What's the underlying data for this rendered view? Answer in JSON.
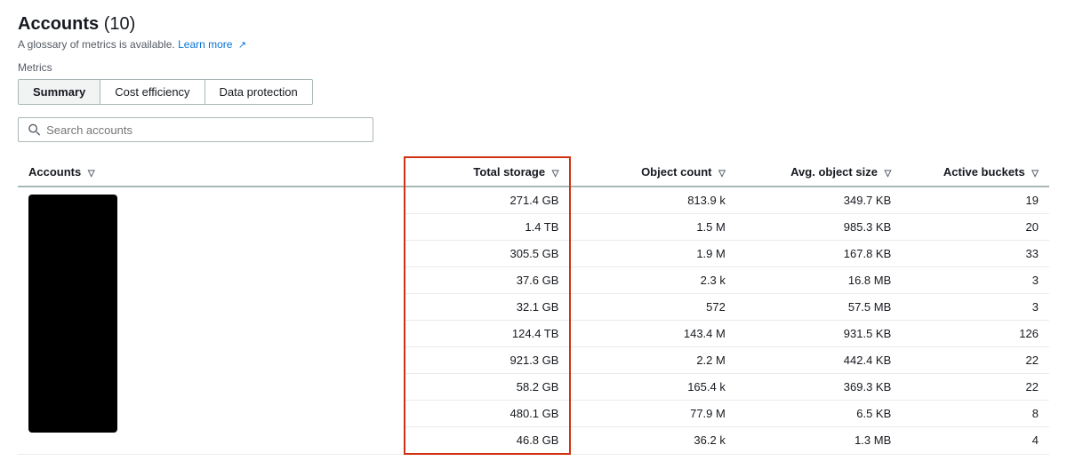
{
  "header": {
    "title": "Accounts",
    "count": "(10)",
    "glossary_text": "A glossary of metrics is available.",
    "learn_more": "Learn more",
    "learn_more_icon": "external-link-icon"
  },
  "metrics_label": "Metrics",
  "tabs": [
    {
      "id": "summary",
      "label": "Summary",
      "active": true
    },
    {
      "id": "cost-efficiency",
      "label": "Cost efficiency",
      "active": false
    },
    {
      "id": "data-protection",
      "label": "Data protection",
      "active": false
    }
  ],
  "search": {
    "placeholder": "Search accounts",
    "value": ""
  },
  "table": {
    "columns": [
      {
        "id": "accounts",
        "label": "Accounts",
        "sortable": true
      },
      {
        "id": "total_storage",
        "label": "Total storage",
        "sortable": true,
        "highlighted": true
      },
      {
        "id": "object_count",
        "label": "Object count",
        "sortable": true
      },
      {
        "id": "avg_object_size",
        "label": "Avg. object size",
        "sortable": true
      },
      {
        "id": "active_buckets",
        "label": "Active buckets",
        "sortable": true
      }
    ],
    "rows": [
      {
        "accounts": "",
        "total_storage": "271.4 GB",
        "object_count": "813.9 k",
        "avg_object_size": "349.7 KB",
        "active_buckets": "19"
      },
      {
        "accounts": "",
        "total_storage": "1.4 TB",
        "object_count": "1.5 M",
        "avg_object_size": "985.3 KB",
        "active_buckets": "20"
      },
      {
        "accounts": "",
        "total_storage": "305.5 GB",
        "object_count": "1.9 M",
        "avg_object_size": "167.8 KB",
        "active_buckets": "33"
      },
      {
        "accounts": "",
        "total_storage": "37.6 GB",
        "object_count": "2.3 k",
        "avg_object_size": "16.8 MB",
        "active_buckets": "3"
      },
      {
        "accounts": "",
        "total_storage": "32.1 GB",
        "object_count": "572",
        "avg_object_size": "57.5 MB",
        "active_buckets": "3"
      },
      {
        "accounts": "",
        "total_storage": "124.4 TB",
        "object_count": "143.4 M",
        "avg_object_size": "931.5 KB",
        "active_buckets": "126"
      },
      {
        "accounts": "",
        "total_storage": "921.3 GB",
        "object_count": "2.2 M",
        "avg_object_size": "442.4 KB",
        "active_buckets": "22"
      },
      {
        "accounts": "",
        "total_storage": "58.2 GB",
        "object_count": "165.4 k",
        "avg_object_size": "369.3 KB",
        "active_buckets": "22"
      },
      {
        "accounts": "",
        "total_storage": "480.1 GB",
        "object_count": "77.9 M",
        "avg_object_size": "6.5 KB",
        "active_buckets": "8"
      },
      {
        "accounts": "",
        "total_storage": "46.8 GB",
        "object_count": "36.2 k",
        "avg_object_size": "1.3 MB",
        "active_buckets": "4"
      }
    ]
  }
}
